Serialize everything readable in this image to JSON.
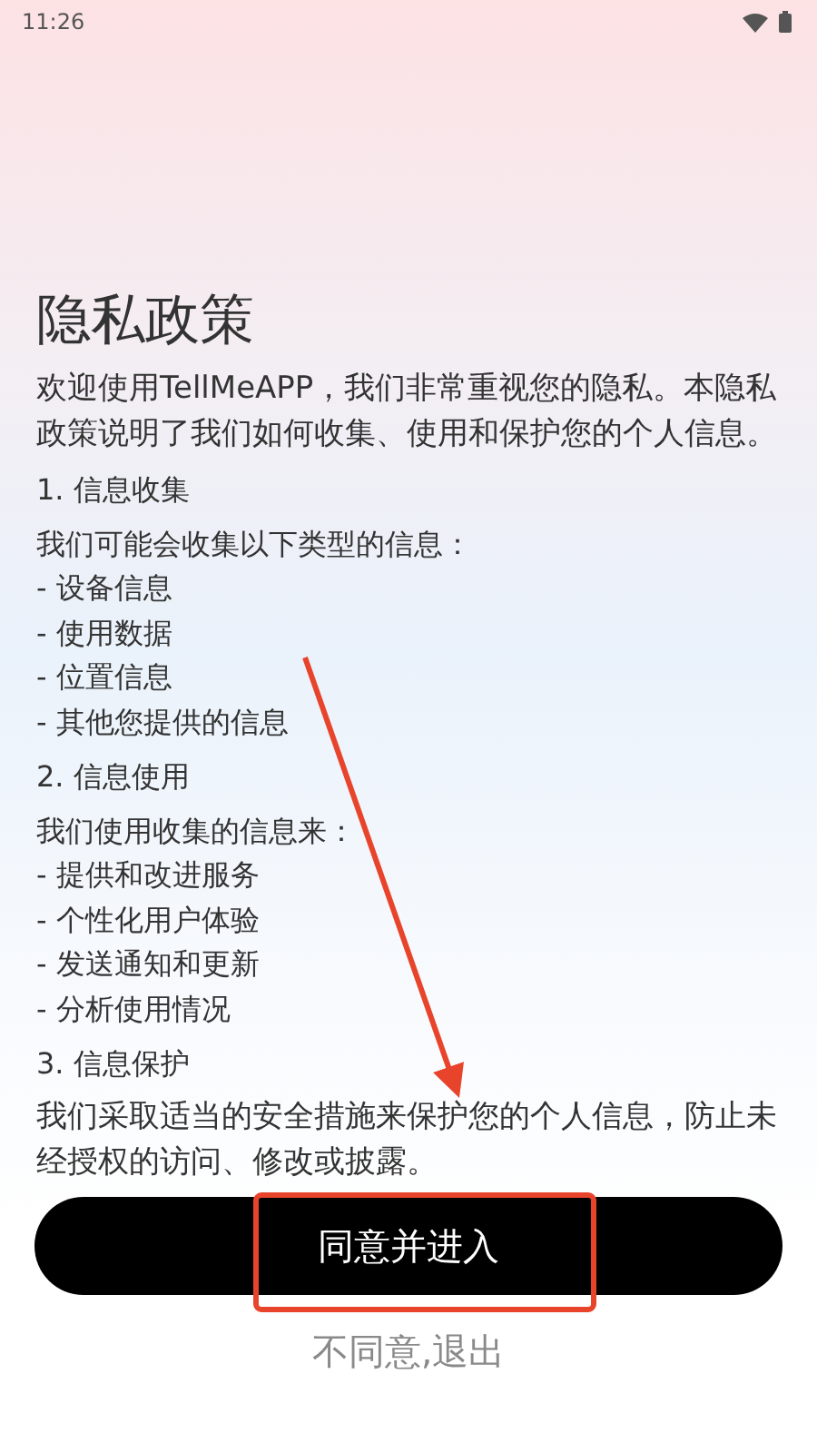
{
  "status_bar": {
    "time": "11:26"
  },
  "title": "隐私政策",
  "intro": "欢迎使用TellMeAPP，我们非常重视您的隐私。本隐私政策说明了我们如何收集、使用和保护您的个人信息。",
  "sections": [
    {
      "heading": "1. 信息收集",
      "body": "我们可能会收集以下类型的信息：",
      "items": [
        "- 设备信息",
        "- 使用数据",
        "- 位置信息",
        "- 其他您提供的信息"
      ]
    },
    {
      "heading": "2. 信息使用",
      "body": "我们使用收集的信息来：",
      "items": [
        "- 提供和改进服务",
        "- 个性化用户体验",
        "- 发送通知和更新",
        "- 分析使用情况"
      ]
    },
    {
      "heading": "3. 信息保护",
      "body": "我们采取适当的安全措施来保护您的个人信息，防止未经授权的访问、修改或披露。"
    }
  ],
  "buttons": [
    {
      "kind": "primary",
      "label": "同意并进入"
    },
    {
      "kind": "text",
      "label": "不同意,退出"
    }
  ]
}
